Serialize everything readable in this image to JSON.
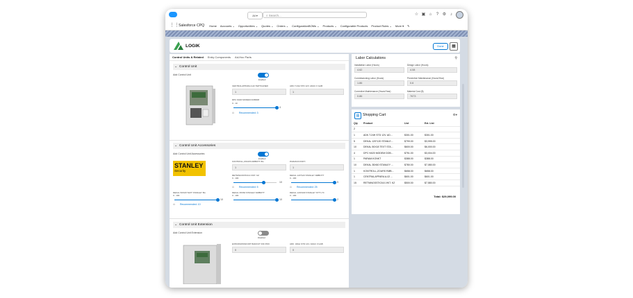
{
  "topbar": {
    "scope": "All ▾",
    "search_placeholder": "Search..."
  },
  "nav": {
    "app_name": "Salesforce CPQ",
    "items": [
      "Home",
      "Accounts ⌄",
      "Opportunities ⌄",
      "Quotes ⌄",
      "Orders ⌄",
      "ConfigurationBOMs ⌄",
      "Products ⌄",
      "Configurable Products",
      "Product Rules ⌄",
      "More ▾"
    ]
  },
  "header": {
    "logo_text": "LOGIK",
    "done_label": "Done"
  },
  "tabs": [
    "Control Units & Related",
    "Entry Components",
    "Ad-Hoc Parts"
  ],
  "control_unit": {
    "title": "Control Unit",
    "add_label": "Add Control Unit",
    "toggle_state": "Enabled",
    "field1_label": "CENTRALAPPARA A-02 SWITCHNER",
    "field1_value": "1",
    "field2_label": "ADK.T.24H STD 12V. ADAC II GAB",
    "field2_value": "1",
    "slider_label": "DPC N020 MODEM DOB008",
    "slider_range": "0 - 10",
    "slider_max": "4",
    "slider_value": 4,
    "slider_max_value": 10,
    "recommended": "Recommended: 3"
  },
  "accessories": {
    "title": "Control Unit Accessories",
    "add_label": "Add Control Unit Accessories",
    "toggle_state": "Enabled",
    "brand": "STANLEY",
    "brand_sub": "Security",
    "f1_label": "KONTROLL,ZOURS RØBOTT 8G",
    "f1_value": "1",
    "f2_label": "PARAM.KONKTI",
    "f2_value": "1",
    "s1_label": "RETNINGSSTICKA VIKT. KZ",
    "s1_range": "0 - 100",
    "s1_max": "10",
    "s1_value": 7,
    "s1_rec": "Recommended: 5",
    "s2_label": "DEKAL 120*120 STANLEY RØBOTT",
    "s2_range": "0 - 100",
    "s2_max": "5",
    "s2_value": 5,
    "s2_rec": "Recommended: 25",
    "s3_label": "DEKAL 50X18 TEXT STANLEY 8G",
    "s3_range": "0 - 100",
    "s3_max": "10",
    "s3_value": 10,
    "s3_rec": "Recommended: 10",
    "s4_label": "DEKAL 35X60 STANLEY RØBOTT",
    "s4_range": "0 - 100",
    "s4_max": "10",
    "s4_value": 10,
    "s5_label": "DEKAL 120X100 STANLEY STTY-70",
    "s5_range": "0 - 100",
    "s5_max": "2",
    "s5_value": 2
  },
  "extension": {
    "title": "Control Unit Extension",
    "add_label": "Add Control Unit Extension",
    "toggle_state": "Disabled",
    "f1_label": "EXPANSIONSKORT BADOUT INK PRO",
    "f1_value": "0",
    "f2_label": "ADK. 18AH STD 12V. ADAC II GAB",
    "f2_value": "0"
  },
  "labor": {
    "title": "Labor Calculations",
    "fields": [
      {
        "label": "Installation Labor (Hours)",
        "value": "4.62"
      },
      {
        "label": "Design Labor (Hours)",
        "value": "4.08"
      },
      {
        "label": "Commissioning Labor (Hours)",
        "value": "1.86"
      },
      {
        "label": "Preventive Maintenance (Hours/Year)",
        "value": "0.6"
      },
      {
        "label": "Corrective Maintenance (Hours/Year)",
        "value": "0.86"
      },
      {
        "label": "Material Cost ($)",
        "value": "7673"
      }
    ]
  },
  "cart": {
    "title": "Shopping Cart",
    "headers": [
      "Qty",
      "Product",
      "List",
      "Ext. List"
    ],
    "rows": [
      [
        "2",
        "",
        "",
        ""
      ],
      [
        "1",
        "ADK.T.24H STD 12V. AD...",
        "$301.00",
        "$301.00"
      ],
      [
        "5",
        "DEKAL 120*120 STANLE...",
        "$799.00",
        "$3,995.00"
      ],
      [
        "10",
        "DEKAL 50X18 TEXT STA...",
        "$600.00",
        "$6,000.00"
      ],
      [
        "4",
        "DPC N020 MODEM DOB...",
        "$751.00",
        "$3,004.00"
      ],
      [
        "1",
        "PARAM.KONKT",
        "$388.00",
        "$388.00"
      ],
      [
        "10",
        "DEKAL 35X60 STANLEY ...",
        "$780.00",
        "$7,080.00"
      ],
      [
        "1",
        "KONTROLL,ZOURS RØB...",
        "$658.00",
        "$658.00"
      ],
      [
        "1",
        "CENTRALAPPARA A-02 ...",
        "$601.00",
        "$601.00"
      ],
      [
        "15",
        "RETNINGSSTICKA VIKT. KZ",
        "$500.00",
        "$7,580.00"
      ]
    ],
    "total_label": "Total:",
    "total_value": "$29,099.00"
  },
  "colors": {
    "accent": "#0176d3",
    "banner": "#7e8fb3",
    "brand_yellow": "#f2c200",
    "toggle_off": "#8a8a8a"
  }
}
